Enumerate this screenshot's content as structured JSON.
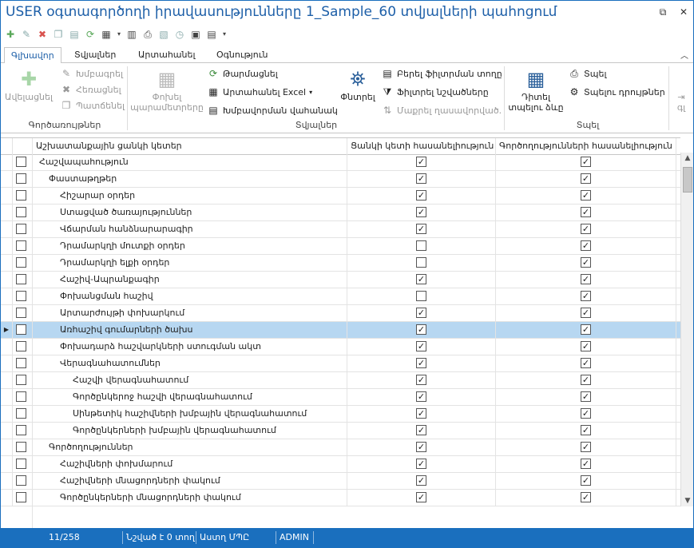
{
  "window": {
    "title": "USER օգտագործողի իրավասությունները 1_Sample_60 տվյալների պահոցում",
    "controls": {
      "restore": "⧉",
      "close": "✕"
    }
  },
  "qat": {
    "icons": [
      "add-icon",
      "edit-icon",
      "delete-icon",
      "copy-icon",
      "view-icon",
      "refresh-icon",
      "excel-icon",
      "print-preview-icon",
      "print-icon",
      "export-icon",
      "history-icon",
      "layout-icon",
      "columns-icon",
      "more-icon"
    ]
  },
  "tabs": [
    {
      "label": "Գլխավոր",
      "active": true
    },
    {
      "label": "Տվյալներ",
      "active": false
    },
    {
      "label": "Արտահանել",
      "active": false
    },
    {
      "label": "Օգնություն",
      "active": false
    }
  ],
  "ribbon": {
    "group1": {
      "label": "Գործառույթներ",
      "add": "Ավելացնել",
      "edit": "Խմբագրել",
      "delete": "Հեռացնել",
      "copy": "Պատճենել"
    },
    "group2": {
      "label": "Տվյալներ",
      "change_settings": "Փոխել պարամետրերը",
      "refresh": "Թարմացնել",
      "export_excel": "Արտահանել Excel",
      "grouping_panel": "Խմբավորման վահանակ",
      "find": "Փնտրել",
      "show_filter_row": "Բերել ֆիլտրման տողը",
      "filter_selected": "Ֆիլտրել նշվածները",
      "clear_filter": "Մաքրել ղասավորված."
    },
    "group3": {
      "label": "Տպել",
      "view_print_form": "Դիտել տպելու ձևը",
      "print": "Տպել",
      "print_settings": "Տպելու դրույթներ",
      "extra": "գլ"
    }
  },
  "grid": {
    "columns": {
      "name": "Աշխատանքային ցանկի կետեր",
      "menu_access": "Ցանկի կետի հասանելիություն",
      "ops_access": "Գործողությունների հասանելիություն"
    },
    "rows": [
      {
        "name": "Հաշվապահություն",
        "level": 0,
        "a": true,
        "b": true,
        "selected": false
      },
      {
        "name": "Փաստաթղթեր",
        "level": 1,
        "a": true,
        "b": true,
        "selected": false
      },
      {
        "name": "Հիշարար օրդեր",
        "level": 2,
        "a": true,
        "b": true,
        "selected": false
      },
      {
        "name": "Ստացված ծառայություններ",
        "level": 2,
        "a": true,
        "b": true,
        "selected": false
      },
      {
        "name": "Վճարման հանձնարարագիր",
        "level": 2,
        "a": true,
        "b": true,
        "selected": false
      },
      {
        "name": "Դրամարկղի մուտքի օրդեր",
        "level": 2,
        "a": false,
        "b": true,
        "selected": false
      },
      {
        "name": "Դրամարկղի ելքի օրդեր",
        "level": 2,
        "a": false,
        "b": true,
        "selected": false
      },
      {
        "name": "Հաշիվ-Ապրանքագիր",
        "level": 2,
        "a": true,
        "b": true,
        "selected": false
      },
      {
        "name": "Փոխանցման հաշիվ",
        "level": 2,
        "a": false,
        "b": true,
        "selected": false
      },
      {
        "name": "Արտարժույթի փոխարկում",
        "level": 2,
        "a": true,
        "b": true,
        "selected": false
      },
      {
        "name": "Առհաշիվ գումարների ծախս",
        "level": 2,
        "a": true,
        "b": true,
        "selected": true
      },
      {
        "name": "Փոխադարձ հաշվարկների ստուգման ակտ",
        "level": 2,
        "a": true,
        "b": true,
        "selected": false
      },
      {
        "name": "Վերագնահատումներ",
        "level": 2,
        "a": true,
        "b": true,
        "selected": false
      },
      {
        "name": "Հաշվի վերագնահատում",
        "level": 3,
        "a": true,
        "b": true,
        "selected": false
      },
      {
        "name": "Գործընկերոջ հաշվի վերագնահատում",
        "level": 3,
        "a": true,
        "b": true,
        "selected": false
      },
      {
        "name": "Սինթետիկ հաշիվների խմբային վերագնահատում",
        "level": 3,
        "a": true,
        "b": true,
        "selected": false
      },
      {
        "name": "Գործընկերների խմբային վերագնահատում",
        "level": 3,
        "a": true,
        "b": true,
        "selected": false
      },
      {
        "name": "Գործողություններ",
        "level": 1,
        "a": true,
        "b": true,
        "selected": false
      },
      {
        "name": "Հաշիվների փոխմարում",
        "level": 2,
        "a": true,
        "b": true,
        "selected": false
      },
      {
        "name": "Հաշիվների մնացորդների փակում",
        "level": 2,
        "a": true,
        "b": true,
        "selected": false
      },
      {
        "name": "Գործընկերների մնացորդների փակում",
        "level": 2,
        "a": true,
        "b": true,
        "selected": false
      }
    ]
  },
  "statusbar": {
    "position": "11/258",
    "marked": "Նշված է 0 տող",
    "db": "Աստղ ՄՊԸ",
    "user": "ADMIN"
  },
  "colors": {
    "accent": "#1a6fbe",
    "selected_row": "#b7d7f1",
    "title": "#1d5fa8"
  }
}
